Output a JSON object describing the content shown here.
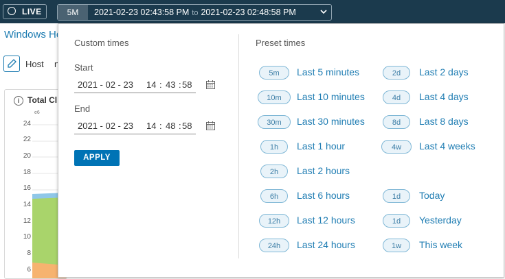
{
  "topbar": {
    "live_label": "LIVE",
    "range_chip": "5M",
    "range_start": "2021-02-23 02:43:58 PM",
    "range_to": "to",
    "range_end": "2021-02-23 02:48:58 PM"
  },
  "page": {
    "title": "Windows He",
    "host_label": "Host",
    "host_value": "n",
    "card_title": "Total Cl",
    "card_unit": "e6",
    "y_ticks": [
      "24",
      "22",
      "20",
      "18",
      "16",
      "14",
      "12",
      "10",
      "8",
      "6"
    ]
  },
  "popover": {
    "custom_title": "Custom times",
    "start_label": "Start",
    "start": {
      "date": "2021 - 02 - 23",
      "hour": "14",
      "minute": "43",
      "second": "58"
    },
    "end_label": "End",
    "end": {
      "date": "2021 - 02 - 23",
      "hour": "14",
      "minute": "48",
      "second": "58"
    },
    "apply_label": "APPLY",
    "preset_title": "Preset times",
    "presets_left": [
      {
        "chip": "5m",
        "label": "Last 5 minutes"
      },
      {
        "chip": "10m",
        "label": "Last 10 minutes"
      },
      {
        "chip": "30m",
        "label": "Last 30 minutes"
      },
      {
        "chip": "1h",
        "label": "Last 1 hour"
      },
      {
        "chip": "2h",
        "label": "Last 2 hours"
      },
      {
        "chip": "6h",
        "label": "Last 6 hours"
      },
      {
        "chip": "12h",
        "label": "Last 12 hours"
      },
      {
        "chip": "24h",
        "label": "Last 24 hours"
      }
    ],
    "presets_right": [
      {
        "chip": "2d",
        "label": "Last 2 days"
      },
      {
        "chip": "4d",
        "label": "Last 4 days"
      },
      {
        "chip": "8d",
        "label": "Last 8 days"
      },
      {
        "chip": "4w",
        "label": "Last 4 weeks"
      },
      {
        "chip": "1d",
        "label": "Today"
      },
      {
        "chip": "1d",
        "label": "Yesterday"
      },
      {
        "chip": "1w",
        "label": "This week"
      }
    ]
  },
  "colors": {
    "topbar": "#1b3a4d",
    "link": "#1f7db3",
    "apply": "#0073b5",
    "chip_border": "#7fb7d6"
  }
}
